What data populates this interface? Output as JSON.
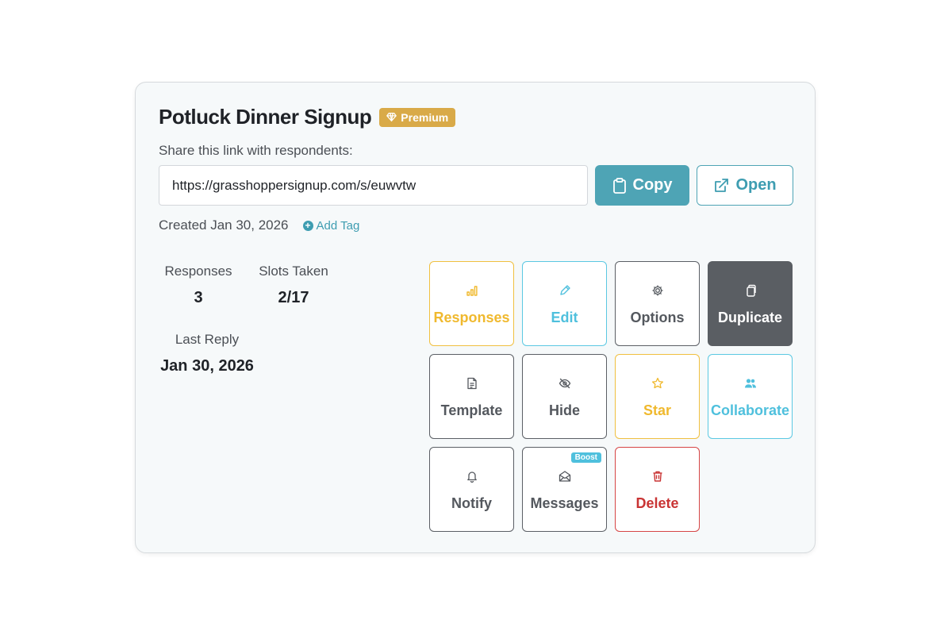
{
  "header": {
    "title": "Potluck Dinner Signup",
    "badge": "Premium",
    "badge_icon": "diamond-icon"
  },
  "share": {
    "label": "Share this link with respondents:",
    "url": "https://grasshoppersignup.com/s/euwvtw",
    "copy_label": "Copy",
    "open_label": "Open"
  },
  "meta": {
    "created": "Created Jan 30, 2026",
    "add_tag": "Add Tag"
  },
  "stats": {
    "responses_label": "Responses",
    "responses_value": "3",
    "slots_label": "Slots Taken",
    "slots_value": "2/17",
    "last_reply_label": "Last Reply",
    "last_reply_value": "Jan 30, 2026"
  },
  "actions": [
    {
      "label": "Responses",
      "icon": "bar-chart-icon"
    },
    {
      "label": "Edit",
      "icon": "pencil-icon"
    },
    {
      "label": "Options",
      "icon": "gear-icon"
    },
    {
      "label": "Duplicate",
      "icon": "copy-icon"
    },
    {
      "label": "Template",
      "icon": "document-icon"
    },
    {
      "label": "Hide",
      "icon": "eye-off-icon"
    },
    {
      "label": "Star",
      "icon": "star-icon"
    },
    {
      "label": "Collaborate",
      "icon": "users-icon"
    },
    {
      "label": "Notify",
      "icon": "bell-icon"
    },
    {
      "label": "Messages",
      "icon": "envelope-icon",
      "badge": "Boost"
    },
    {
      "label": "Delete",
      "icon": "trash-icon"
    }
  ],
  "colors": {
    "accent": "#4ea4b5",
    "premium": "#d9aa48",
    "yellow": "#f0b92e",
    "cyan": "#4fc0dd",
    "dark": "#5a5e63",
    "danger": "#c93434"
  }
}
